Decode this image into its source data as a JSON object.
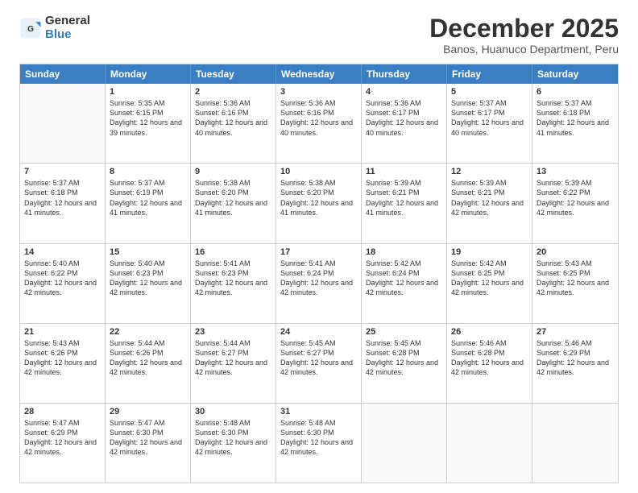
{
  "logo": {
    "general": "General",
    "blue": "Blue"
  },
  "title": "December 2025",
  "subtitle": "Banos, Huanuco Department, Peru",
  "header_days": [
    "Sunday",
    "Monday",
    "Tuesday",
    "Wednesday",
    "Thursday",
    "Friday",
    "Saturday"
  ],
  "weeks": [
    [
      {
        "day": "",
        "empty": true
      },
      {
        "day": "1",
        "sunrise": "Sunrise: 5:35 AM",
        "sunset": "Sunset: 6:15 PM",
        "daylight": "Daylight: 12 hours and 39 minutes."
      },
      {
        "day": "2",
        "sunrise": "Sunrise: 5:36 AM",
        "sunset": "Sunset: 6:16 PM",
        "daylight": "Daylight: 12 hours and 40 minutes."
      },
      {
        "day": "3",
        "sunrise": "Sunrise: 5:36 AM",
        "sunset": "Sunset: 6:16 PM",
        "daylight": "Daylight: 12 hours and 40 minutes."
      },
      {
        "day": "4",
        "sunrise": "Sunrise: 5:36 AM",
        "sunset": "Sunset: 6:17 PM",
        "daylight": "Daylight: 12 hours and 40 minutes."
      },
      {
        "day": "5",
        "sunrise": "Sunrise: 5:37 AM",
        "sunset": "Sunset: 6:17 PM",
        "daylight": "Daylight: 12 hours and 40 minutes."
      },
      {
        "day": "6",
        "sunrise": "Sunrise: 5:37 AM",
        "sunset": "Sunset: 6:18 PM",
        "daylight": "Daylight: 12 hours and 41 minutes."
      }
    ],
    [
      {
        "day": "7",
        "sunrise": "Sunrise: 5:37 AM",
        "sunset": "Sunset: 6:18 PM",
        "daylight": "Daylight: 12 hours and 41 minutes."
      },
      {
        "day": "8",
        "sunrise": "Sunrise: 5:37 AM",
        "sunset": "Sunset: 6:19 PM",
        "daylight": "Daylight: 12 hours and 41 minutes."
      },
      {
        "day": "9",
        "sunrise": "Sunrise: 5:38 AM",
        "sunset": "Sunset: 6:20 PM",
        "daylight": "Daylight: 12 hours and 41 minutes."
      },
      {
        "day": "10",
        "sunrise": "Sunrise: 5:38 AM",
        "sunset": "Sunset: 6:20 PM",
        "daylight": "Daylight: 12 hours and 41 minutes."
      },
      {
        "day": "11",
        "sunrise": "Sunrise: 5:39 AM",
        "sunset": "Sunset: 6:21 PM",
        "daylight": "Daylight: 12 hours and 41 minutes."
      },
      {
        "day": "12",
        "sunrise": "Sunrise: 5:39 AM",
        "sunset": "Sunset: 6:21 PM",
        "daylight": "Daylight: 12 hours and 42 minutes."
      },
      {
        "day": "13",
        "sunrise": "Sunrise: 5:39 AM",
        "sunset": "Sunset: 6:22 PM",
        "daylight": "Daylight: 12 hours and 42 minutes."
      }
    ],
    [
      {
        "day": "14",
        "sunrise": "Sunrise: 5:40 AM",
        "sunset": "Sunset: 6:22 PM",
        "daylight": "Daylight: 12 hours and 42 minutes."
      },
      {
        "day": "15",
        "sunrise": "Sunrise: 5:40 AM",
        "sunset": "Sunset: 6:23 PM",
        "daylight": "Daylight: 12 hours and 42 minutes."
      },
      {
        "day": "16",
        "sunrise": "Sunrise: 5:41 AM",
        "sunset": "Sunset: 6:23 PM",
        "daylight": "Daylight: 12 hours and 42 minutes."
      },
      {
        "day": "17",
        "sunrise": "Sunrise: 5:41 AM",
        "sunset": "Sunset: 6:24 PM",
        "daylight": "Daylight: 12 hours and 42 minutes."
      },
      {
        "day": "18",
        "sunrise": "Sunrise: 5:42 AM",
        "sunset": "Sunset: 6:24 PM",
        "daylight": "Daylight: 12 hours and 42 minutes."
      },
      {
        "day": "19",
        "sunrise": "Sunrise: 5:42 AM",
        "sunset": "Sunset: 6:25 PM",
        "daylight": "Daylight: 12 hours and 42 minutes."
      },
      {
        "day": "20",
        "sunrise": "Sunrise: 5:43 AM",
        "sunset": "Sunset: 6:25 PM",
        "daylight": "Daylight: 12 hours and 42 minutes."
      }
    ],
    [
      {
        "day": "21",
        "sunrise": "Sunrise: 5:43 AM",
        "sunset": "Sunset: 6:26 PM",
        "daylight": "Daylight: 12 hours and 42 minutes."
      },
      {
        "day": "22",
        "sunrise": "Sunrise: 5:44 AM",
        "sunset": "Sunset: 6:26 PM",
        "daylight": "Daylight: 12 hours and 42 minutes."
      },
      {
        "day": "23",
        "sunrise": "Sunrise: 5:44 AM",
        "sunset": "Sunset: 6:27 PM",
        "daylight": "Daylight: 12 hours and 42 minutes."
      },
      {
        "day": "24",
        "sunrise": "Sunrise: 5:45 AM",
        "sunset": "Sunset: 6:27 PM",
        "daylight": "Daylight: 12 hours and 42 minutes."
      },
      {
        "day": "25",
        "sunrise": "Sunrise: 5:45 AM",
        "sunset": "Sunset: 6:28 PM",
        "daylight": "Daylight: 12 hours and 42 minutes."
      },
      {
        "day": "26",
        "sunrise": "Sunrise: 5:46 AM",
        "sunset": "Sunset: 6:28 PM",
        "daylight": "Daylight: 12 hours and 42 minutes."
      },
      {
        "day": "27",
        "sunrise": "Sunrise: 5:46 AM",
        "sunset": "Sunset: 6:29 PM",
        "daylight": "Daylight: 12 hours and 42 minutes."
      }
    ],
    [
      {
        "day": "28",
        "sunrise": "Sunrise: 5:47 AM",
        "sunset": "Sunset: 6:29 PM",
        "daylight": "Daylight: 12 hours and 42 minutes."
      },
      {
        "day": "29",
        "sunrise": "Sunrise: 5:47 AM",
        "sunset": "Sunset: 6:30 PM",
        "daylight": "Daylight: 12 hours and 42 minutes."
      },
      {
        "day": "30",
        "sunrise": "Sunrise: 5:48 AM",
        "sunset": "Sunset: 6:30 PM",
        "daylight": "Daylight: 12 hours and 42 minutes."
      },
      {
        "day": "31",
        "sunrise": "Sunrise: 5:48 AM",
        "sunset": "Sunset: 6:30 PM",
        "daylight": "Daylight: 12 hours and 42 minutes."
      },
      {
        "day": "",
        "empty": true
      },
      {
        "day": "",
        "empty": true
      },
      {
        "day": "",
        "empty": true
      }
    ]
  ]
}
